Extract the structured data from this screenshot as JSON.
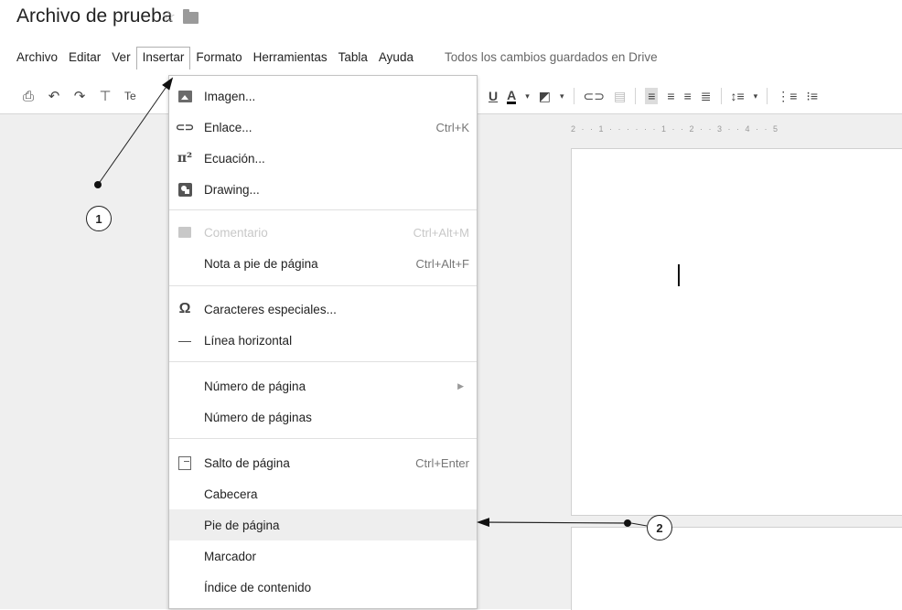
{
  "doc": {
    "title": "Archivo de prueba",
    "star_icon": "star-outline-icon",
    "folder_icon": "folder-icon"
  },
  "menubar": {
    "items": [
      "Archivo",
      "Editar",
      "Ver",
      "Insertar",
      "Formato",
      "Herramientas",
      "Tabla",
      "Ayuda"
    ],
    "active": "Insertar",
    "saved_status": "Todos los cambios guardados en Drive"
  },
  "toolbar": {
    "left_icons": [
      "print-icon",
      "undo-icon",
      "redo-icon",
      "paint-format-icon"
    ],
    "style_label_partial": "Te",
    "right_icons": [
      "underline-icon",
      "text-color-icon",
      "highlight-color-icon",
      "link-icon",
      "comment-icon",
      "align-left-icon",
      "align-center-icon",
      "align-right-icon",
      "justify-icon",
      "line-spacing-icon",
      "numbered-list-icon",
      "bulleted-list-icon"
    ]
  },
  "ruler_text": "2 · · 1 · · · · · · 1 · · 2 · · 3 · · 4 · · 5",
  "insert_menu": {
    "items": [
      {
        "label": "Imagen...",
        "icon": "image-icon",
        "shortcut": ""
      },
      {
        "label": "Enlace...",
        "icon": "link-icon",
        "shortcut": "Ctrl+K"
      },
      {
        "label": "Ecuación...",
        "icon": "pi-equation-icon",
        "shortcut": ""
      },
      {
        "label": "Drawing...",
        "icon": "drawing-icon",
        "shortcut": ""
      },
      {
        "label": "Comentario",
        "icon": "comment-icon",
        "shortcut": "Ctrl+Alt+M",
        "disabled": true
      },
      {
        "label": "Nota a pie de página",
        "icon": "",
        "shortcut": "Ctrl+Alt+F"
      },
      {
        "label": "Caracteres especiales...",
        "icon": "omega-icon",
        "shortcut": ""
      },
      {
        "label": "Línea horizontal",
        "icon": "horizontal-line-icon",
        "shortcut": ""
      },
      {
        "label": "Número de página",
        "icon": "",
        "shortcut": "",
        "submenu": true
      },
      {
        "label": "Número de páginas",
        "icon": "",
        "shortcut": ""
      },
      {
        "label": "Salto de página",
        "icon": "page-break-icon",
        "shortcut": "Ctrl+Enter"
      },
      {
        "label": "Cabecera",
        "icon": "",
        "shortcut": ""
      },
      {
        "label": "Pie de página",
        "icon": "",
        "shortcut": "",
        "highlighted": true
      },
      {
        "label": "Marcador",
        "icon": "",
        "shortcut": ""
      },
      {
        "label": "Índice de contenido",
        "icon": "",
        "shortcut": ""
      }
    ],
    "submenu_arrow": "submenu-arrow-icon"
  },
  "annotations": [
    {
      "label": "1"
    },
    {
      "label": "2"
    }
  ]
}
